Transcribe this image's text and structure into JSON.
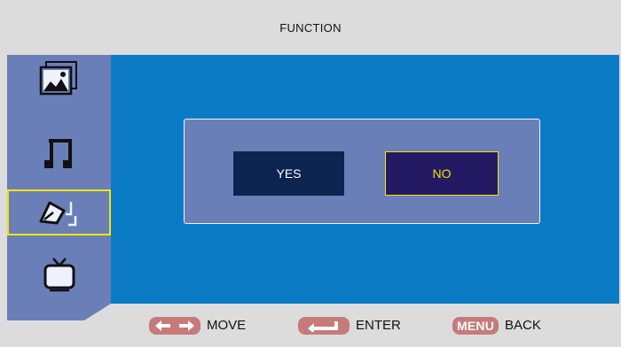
{
  "header": {
    "title": "FUNCTION"
  },
  "sidebar": {
    "items": [
      {
        "icon": "photo-icon",
        "selected": false
      },
      {
        "icon": "music-note-icon",
        "selected": false
      },
      {
        "icon": "setup-pen-icon",
        "selected": true
      },
      {
        "icon": "tv-icon",
        "selected": false
      }
    ]
  },
  "dialog": {
    "yes_label": "YES",
    "no_label": "NO",
    "selected": "NO"
  },
  "footer": {
    "move_label": "MOVE",
    "enter_label": "ENTER",
    "menu_key_label": "MENU",
    "back_label": "BACK"
  },
  "colors": {
    "main_background": "#0a7bc4",
    "sidebar": "#6a7fb8",
    "highlight": "#f2e600",
    "key_badge": "#c77a7a"
  }
}
